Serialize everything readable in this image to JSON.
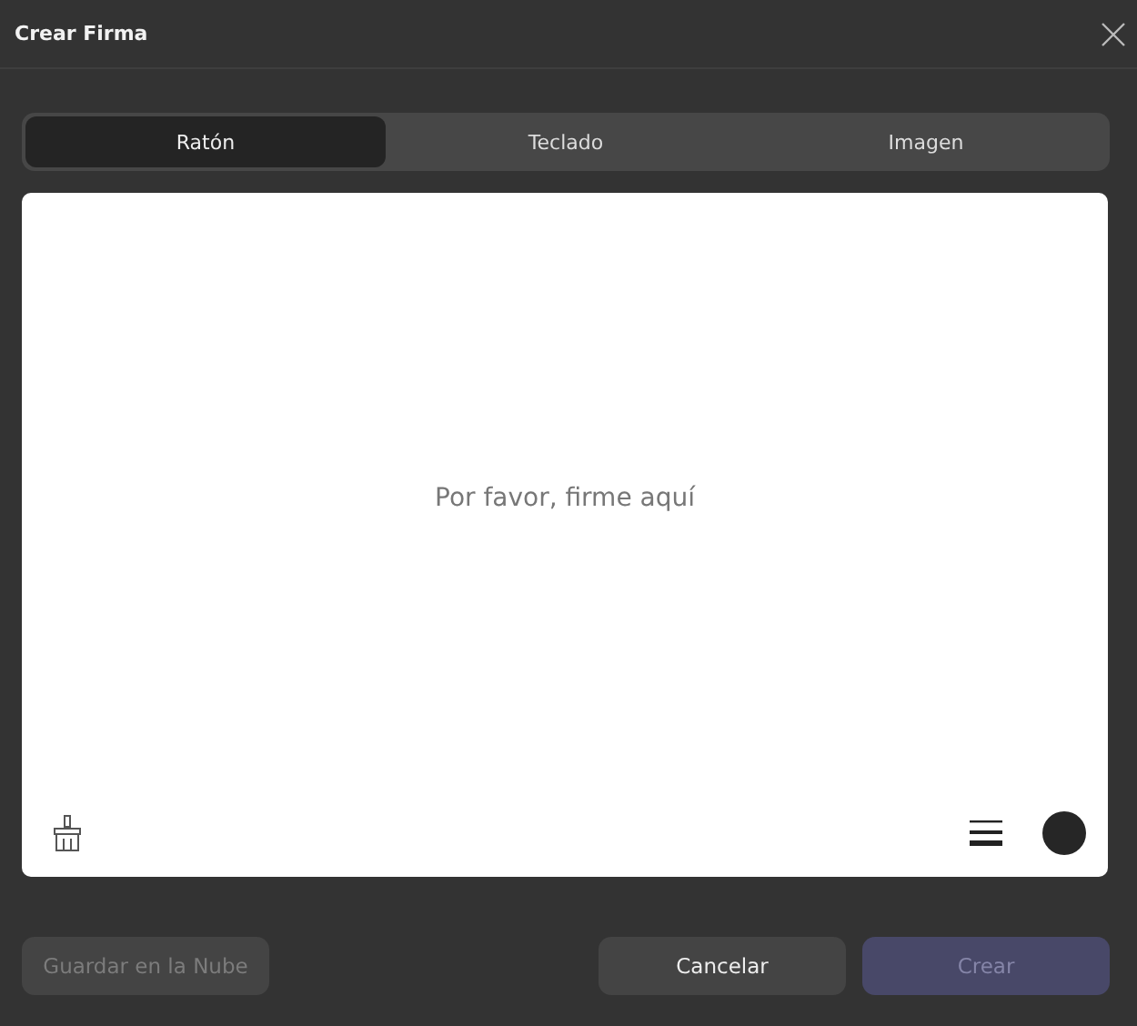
{
  "window": {
    "title": "Crear Firma"
  },
  "tabs": [
    {
      "label": "Ratón",
      "selected": true
    },
    {
      "label": "Teclado",
      "selected": false
    },
    {
      "label": "Imagen",
      "selected": false
    }
  ],
  "canvas": {
    "placeholder": "Por favor, firme aquí"
  },
  "buttons": [
    {
      "label": "Guardar en la Nube",
      "kind": "secondary",
      "disabled": true
    },
    {
      "label": "Cancelar",
      "kind": "secondary",
      "disabled": false
    },
    {
      "label": "Crear",
      "kind": "primary",
      "disabled": true
    }
  ]
}
